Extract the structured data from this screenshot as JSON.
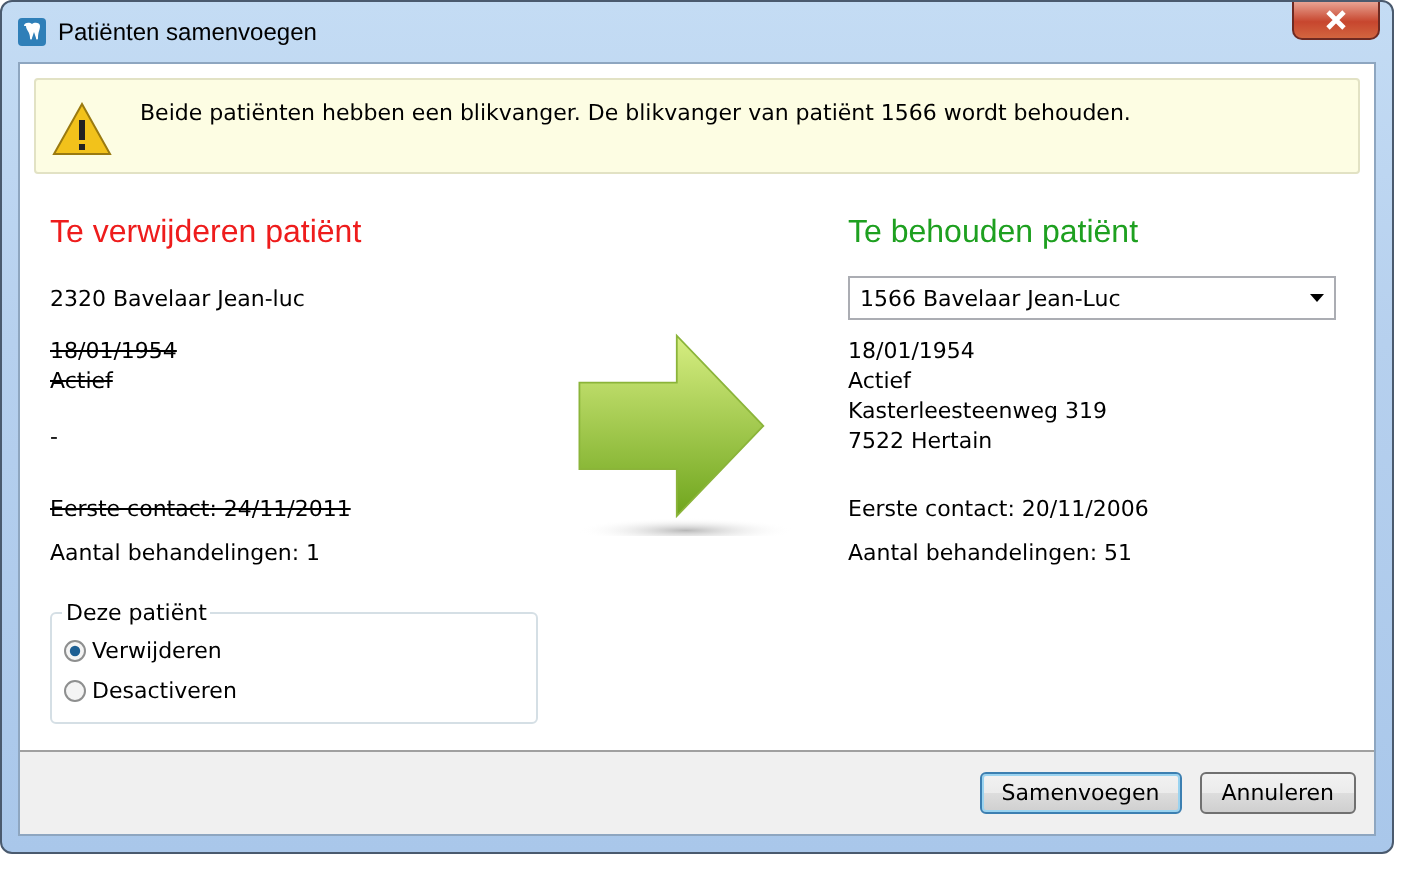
{
  "window": {
    "title": "Patiënten samenvoegen"
  },
  "warning": {
    "text": "Beide patiënten hebben een blikvanger. De blikvanger van patiënt 1566 wordt behouden."
  },
  "remove": {
    "heading": "Te verwijderen patiënt",
    "patient": "2320 Bavelaar Jean-luc",
    "details": [
      [
        {
          "text": "18/01/1954",
          "struck": true
        },
        {
          "text": "Actief",
          "struck": true
        }
      ],
      [
        {
          "text": "-",
          "struck": false
        }
      ]
    ],
    "stats": [
      {
        "text": "Eerste contact: 24/11/2011",
        "struck": true
      },
      {
        "text": "Aantal behandelingen: 1",
        "struck": false
      }
    ]
  },
  "keep": {
    "heading": "Te behouden patiënt",
    "patient_select": "1566 Bavelaar Jean-Luc",
    "details": [
      [
        {
          "text": "18/01/1954",
          "struck": false
        },
        {
          "text": "Actief",
          "struck": false
        },
        {
          "text": "Kasterleesteenweg 319",
          "struck": false
        },
        {
          "text": "7522 Hertain",
          "struck": false
        }
      ]
    ],
    "stats": [
      {
        "text": "Eerste contact: 20/11/2006",
        "struck": false
      },
      {
        "text": "Aantal behandelingen: 51",
        "struck": false
      }
    ]
  },
  "option_group": {
    "legend": "Deze patiënt",
    "options": [
      {
        "label": "Verwijderen",
        "selected": true
      },
      {
        "label": "Desactiveren",
        "selected": false
      }
    ]
  },
  "buttons": [
    {
      "label": "Samenvoegen",
      "default": true
    },
    {
      "label": "Annuleren",
      "default": false
    }
  ]
}
